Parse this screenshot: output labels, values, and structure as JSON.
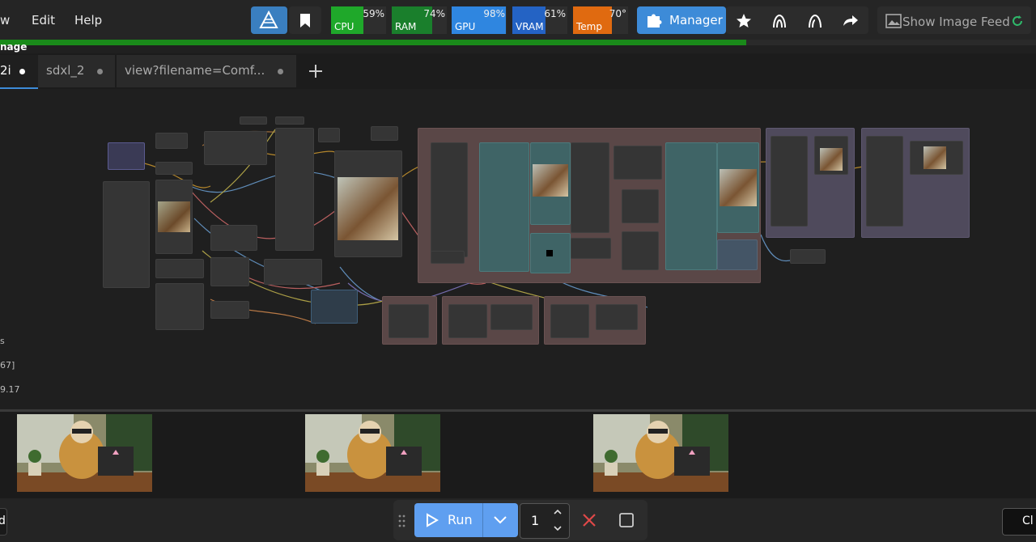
{
  "menu": {
    "item_left": "w",
    "edit": "Edit",
    "help": "Help"
  },
  "monitors": [
    {
      "label": "CPU",
      "percent": "59%",
      "color": "#1fa82a",
      "fill": 0.59
    },
    {
      "label": "RAM",
      "percent": "74%",
      "color": "#1a7f2c",
      "fill": 0.74
    },
    {
      "label": "GPU",
      "percent": "98%",
      "color": "#2f86e0",
      "fill": 0.98
    },
    {
      "label": "VRAM",
      "percent": "61%",
      "color": "#2463c4",
      "fill": 0.61
    },
    {
      "label": "Temp",
      "percent": "70°",
      "color": "#e06a10",
      "fill": 0.7
    }
  ],
  "toolbar": {
    "manager_label": "Manager",
    "image_feed_label": "Show Image Feed"
  },
  "progress": {
    "fraction": 0.72,
    "status_label": "nage"
  },
  "tabs": [
    {
      "label": "2i"
    },
    {
      "label": "sdxl_2"
    },
    {
      "label": "view?filename=Comf..."
    }
  ],
  "side_info": {
    "line1": "s",
    "line2": "67]",
    "line3": "9.17"
  },
  "bottom": {
    "left_partial": "d",
    "run_label": "Run",
    "batch_count": "1",
    "right_partial": "Cl"
  },
  "colors": {
    "accent_blue": "#3d8bd8",
    "group_pink": "#6b5050",
    "group_purple": "#4f4a5c",
    "node_teal": "#3f6466"
  }
}
